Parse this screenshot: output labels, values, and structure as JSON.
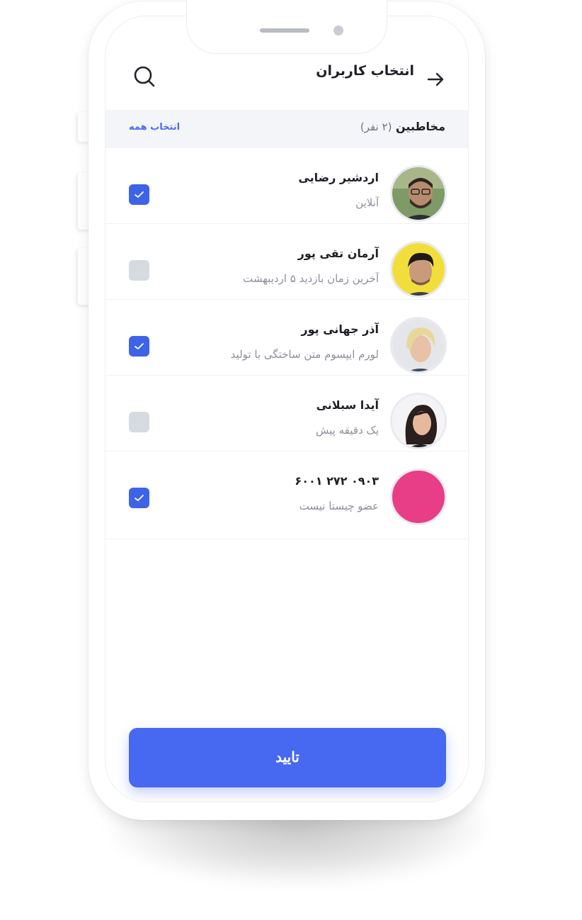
{
  "header": {
    "title": "انتخاب کاربران",
    "back_icon": "arrow-right-icon",
    "search_icon": "search-icon"
  },
  "section": {
    "title": "مخاطبین",
    "count": "(۲ نفر)",
    "select_all": "انتخاب همه"
  },
  "contacts": [
    {
      "name": "اردشیر رضایی",
      "status": "آنلاین",
      "checked": true
    },
    {
      "name": "آرمان تقی پور",
      "status": "آخرین زمان بازدید ۵ اردیبهشت",
      "checked": false
    },
    {
      "name": "آذر جهانی پور",
      "status": "لورم ایپسوم متن ساختگی با تولید",
      "checked": true
    },
    {
      "name": "آیدا سبلانی",
      "status": "یک دقیقه پیش",
      "checked": false
    },
    {
      "name": "۰۹۰۳ ۲۷۲ ۶۰۰۱",
      "status": "عضو چیستا نیست",
      "checked": true
    }
  ],
  "confirm_label": "تایید",
  "colors": {
    "accent": "#4768f0",
    "checkbox_on": "#3d63e6",
    "checkbox_off": "#d6dae1",
    "placeholder_avatar": "#e83e87"
  }
}
